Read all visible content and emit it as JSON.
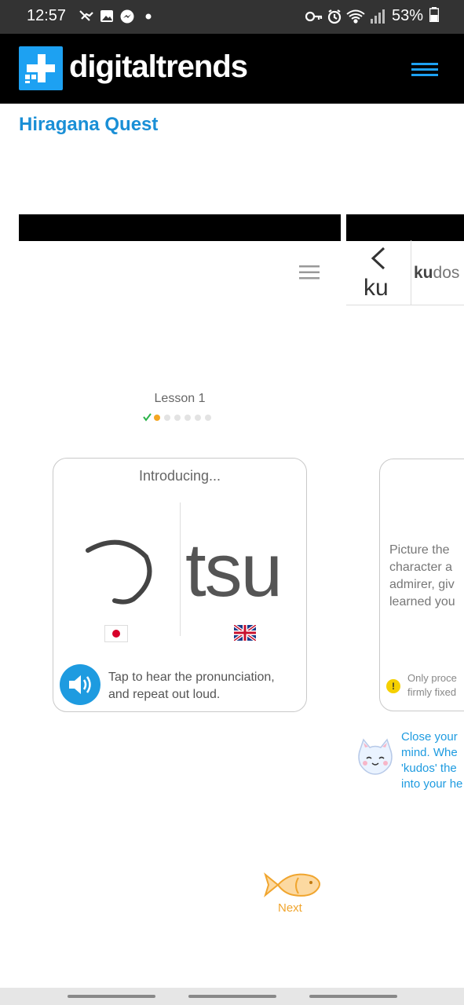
{
  "status_bar": {
    "time": "12:57",
    "battery": "53%",
    "icons_left": [
      "plane-mute-icon",
      "image-icon",
      "messenger-icon",
      "dot-icon"
    ],
    "icons_right": [
      "key-icon",
      "alarm-icon",
      "wifi-icon",
      "signal-icon"
    ],
    "battery_icon": "battery-icon"
  },
  "header": {
    "brand": "digitaltrends",
    "logo_icon": "plus-logo-icon",
    "menu_icon": "hamburger-menu-icon",
    "bg": "#000000",
    "accent": "#1da1f2"
  },
  "page": {
    "title": "Hiragana Quest",
    "title_color": "#1a8fd6"
  },
  "shot1": {
    "lesson_label": "Lesson 1",
    "progress_dots": {
      "total": 7,
      "current": 2
    },
    "card": {
      "intro": "Introducing...",
      "kana": "つ",
      "romaji": "tsu",
      "flags": [
        "japan-flag",
        "uk-flag"
      ],
      "hint_line1": "Tap to hear the pronunciation,",
      "hint_line2": "and repeat out loud."
    },
    "next_label": "Next",
    "next_icon": "fish-icon"
  },
  "shot2": {
    "back_label": "ku",
    "tab_bold": "ku",
    "tab_rest": "dos",
    "picture_text": "Picture the\ncharacter a\nadmirer, giv\nlearned you",
    "warning_text": "Only proce\nfirmly fixed",
    "close_text": "Close your\nmind. Whe\n'kudos' the\ninto your he"
  }
}
